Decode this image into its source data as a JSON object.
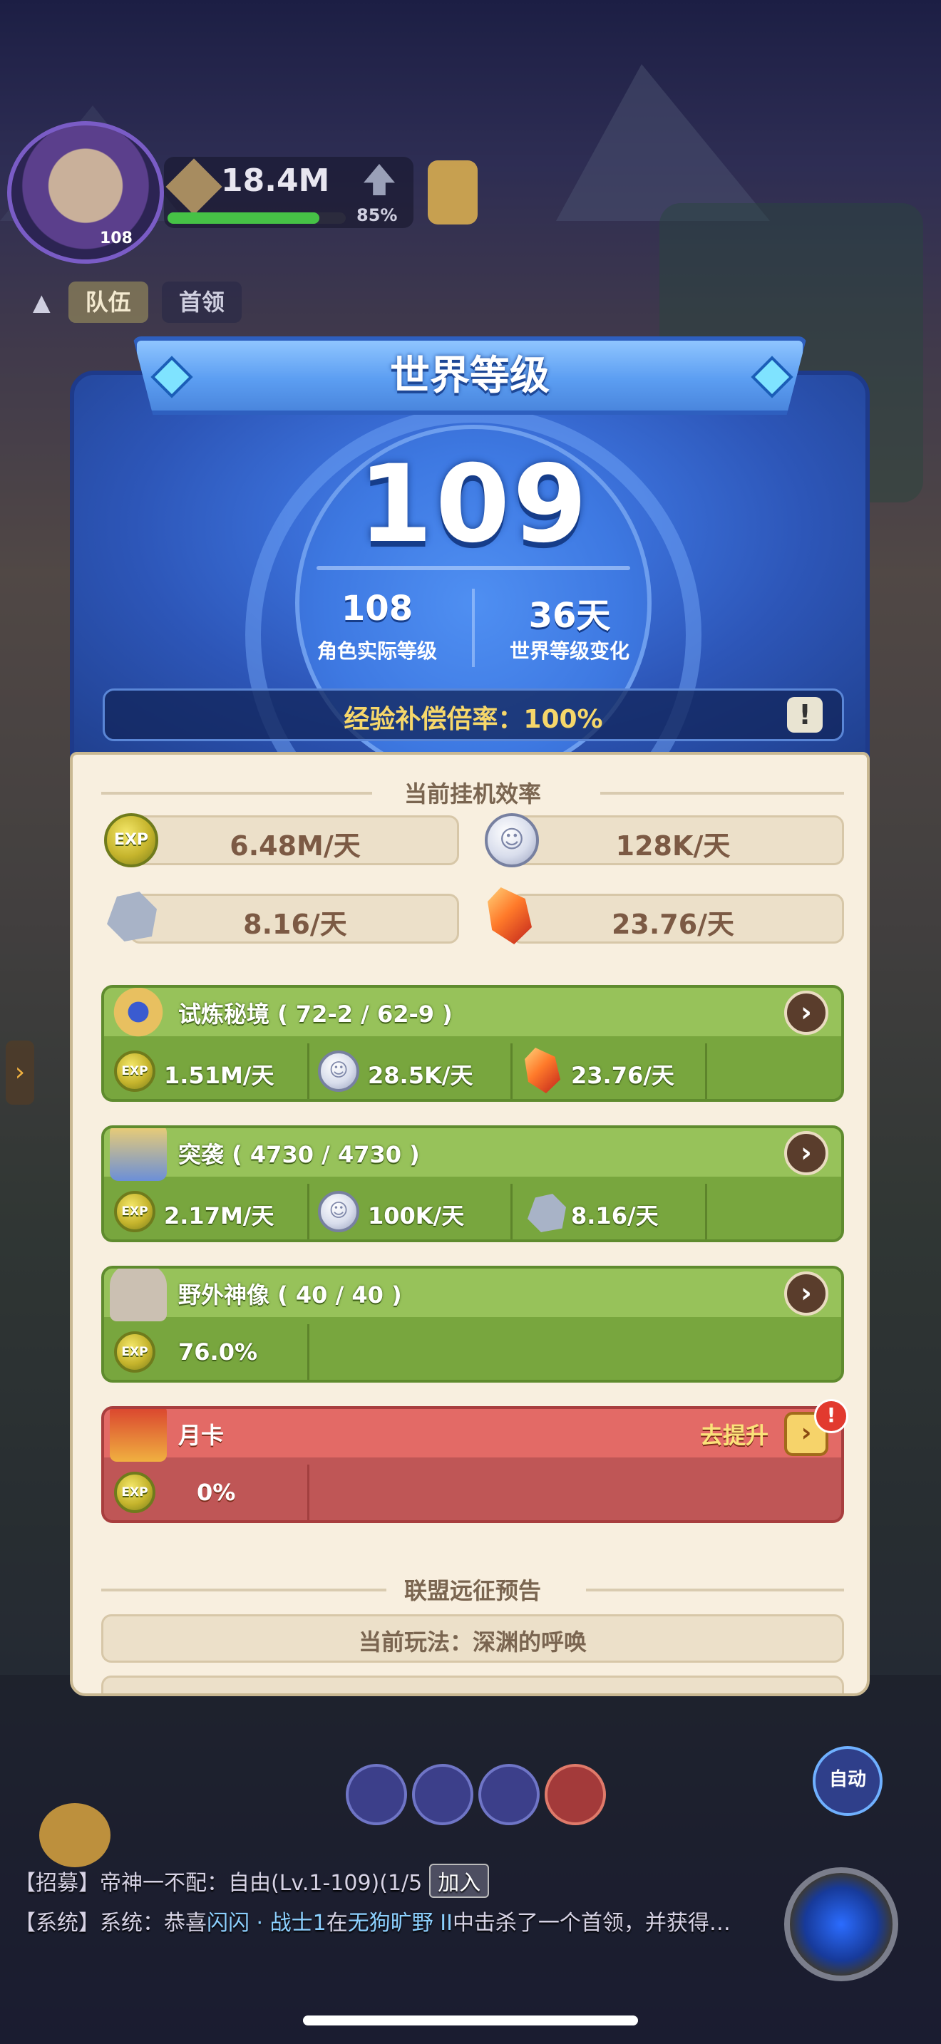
{
  "hud": {
    "avatar_level": "108",
    "power": "18.4M",
    "power_percent": "85%",
    "power_progress": 0.85,
    "tabs": [
      "队伍",
      "首领"
    ]
  },
  "modal": {
    "title": "世界等级",
    "world_level": "109",
    "actual_level_value": "108",
    "actual_level_label": "角色实际等级",
    "change_value": "36天",
    "change_label": "世界等级变化",
    "exp_rate_text": "经验补偿倍率：100%",
    "info_icon": "!",
    "efficiency_title": "当前挂机效率",
    "rates": {
      "exp": "6.48M/天",
      "silver": "128K/天",
      "stone": "8.16/天",
      "crystal": "23.76/天"
    },
    "cards": [
      {
        "title": "试炼秘境 ( 72-2 / 62-9 )",
        "values": [
          "1.51M/天",
          "28.5K/天",
          "23.76/天"
        ]
      },
      {
        "title": "突袭 ( 4730 / 4730 )",
        "values": [
          "2.17M/天",
          "100K/天",
          "8.16/天"
        ]
      },
      {
        "title": "野外神像 ( 40 / 40 )",
        "values": [
          "76.0%"
        ]
      }
    ],
    "monthly_card": {
      "title": "月卡",
      "upgrade_label": "去提升",
      "value": "0%",
      "alert": "!"
    },
    "exp_badge": "EXP",
    "alliance_title": "联盟远征预告",
    "alliance_mode": "当前玩法：深渊的呼唤"
  },
  "bottom": {
    "auto_label": "自动",
    "chat": {
      "line1_prefix": "【招募】帝神一不配：自由(Lv.1-109)(1/5",
      "line1_button": "加入",
      "line2_prefix": "【系统】系统：恭喜",
      "line2_name": "闪闪 · 战士1",
      "line2_mid": "在",
      "line2_place": "无狗旷野 II",
      "line2_suffix": "中击杀了一个首领，并获得…"
    }
  },
  "colors": {
    "modal_blue": "#3a6fd8",
    "panel_cream": "#f8efdf",
    "green_card": "#97c25a",
    "red_card": "#e36a66",
    "gold_text": "#f6d76a"
  },
  "icons": [
    "exp-coin-icon",
    "silver-coin-icon",
    "stone-icon",
    "crystal-icon",
    "chevron-right-icon",
    "gem-icon",
    "hourglass-icon",
    "sword-icon",
    "arrow-up-icon"
  ]
}
